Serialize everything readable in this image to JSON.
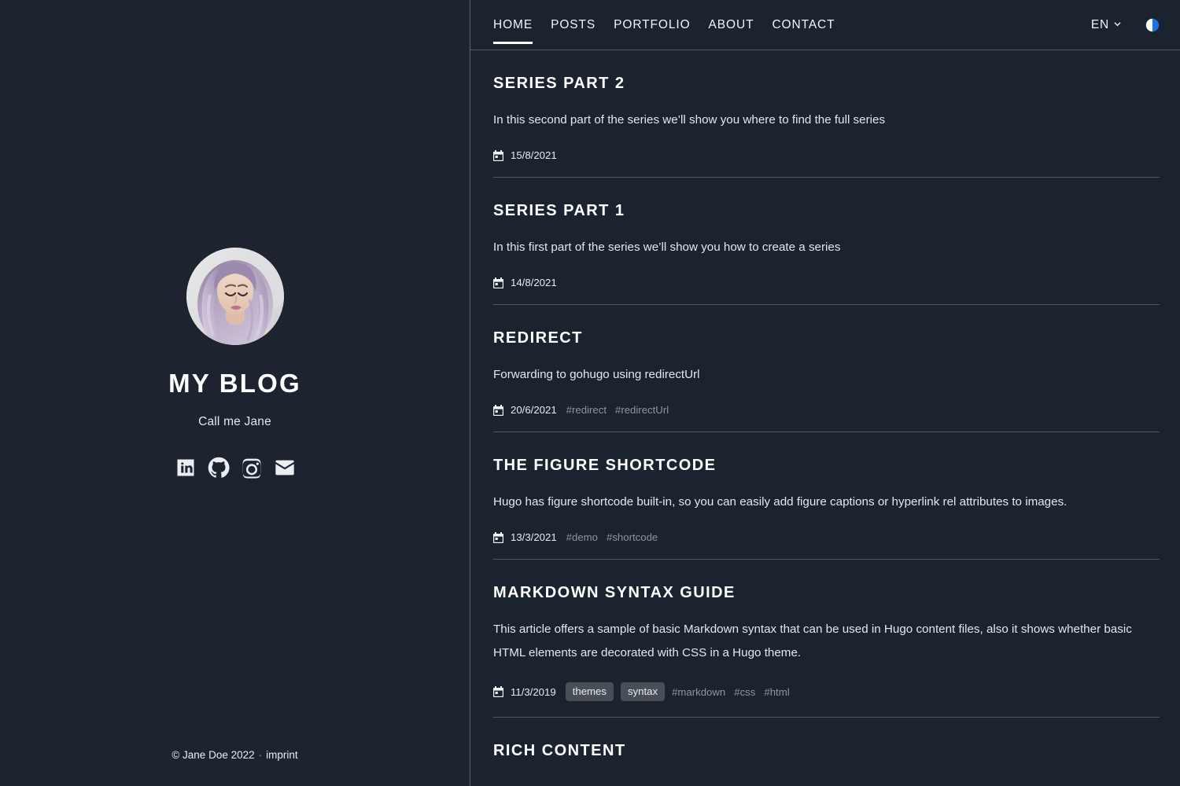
{
  "sidebar": {
    "avatar_alt": "profile-photo",
    "blog_title": "MY BLOG",
    "tagline": "Call me Jane",
    "socials": [
      {
        "name": "linkedin",
        "label": "LinkedIn"
      },
      {
        "name": "github",
        "label": "GitHub"
      },
      {
        "name": "instagram",
        "label": "Instagram"
      },
      {
        "name": "email",
        "label": "Email"
      }
    ],
    "footer": {
      "copyright": "© Jane Doe 2022",
      "separator": "·",
      "imprint_label": "imprint"
    }
  },
  "header": {
    "nav": [
      {
        "label": "HOME",
        "active": true
      },
      {
        "label": "POSTS",
        "active": false
      },
      {
        "label": "PORTFOLIO",
        "active": false
      },
      {
        "label": "ABOUT",
        "active": false
      },
      {
        "label": "CONTACT",
        "active": false
      }
    ],
    "language": "EN",
    "language_icon": "chevron-down-icon",
    "theme_toggle_icon": "half-circle-icon",
    "theme_toggle_color": "#1a73e8"
  },
  "posts": [
    {
      "title": "SERIES PART 2",
      "summary": "In this second part of the series we’ll show you where to find the full series",
      "date": "15/8/2021",
      "categories": [],
      "tags": []
    },
    {
      "title": "SERIES PART 1",
      "summary": "In this first part of the series we’ll show you how to create a series",
      "date": "14/8/2021",
      "categories": [],
      "tags": []
    },
    {
      "title": "REDIRECT",
      "summary": "Forwarding to gohugo using redirectUrl",
      "date": "20/6/2021",
      "categories": [],
      "tags": [
        "#redirect",
        "#redirectUrl"
      ]
    },
    {
      "title": "THE FIGURE SHORTCODE",
      "summary": "Hugo has figure shortcode built-in, so you can easily add figure captions or hyperlink rel attributes to images.",
      "date": "13/3/2021",
      "categories": [],
      "tags": [
        "#demo",
        "#shortcode"
      ]
    },
    {
      "title": "MARKDOWN SYNTAX GUIDE",
      "summary": "This article offers a sample of basic Markdown syntax that can be used in Hugo content files, also it shows whether basic HTML elements are decorated with CSS in a Hugo theme.",
      "date": "11/3/2019",
      "categories": [
        "themes",
        "syntax"
      ],
      "tags": [
        "#markdown",
        "#css",
        "#html"
      ]
    },
    {
      "title": "RICH CONTENT",
      "summary": "",
      "date": "",
      "categories": [],
      "tags": []
    }
  ],
  "theme": {
    "sidebar_bg": "#1d2430",
    "main_bg": "#1b232e",
    "divider": "#5d6168",
    "text": "#e8eaed",
    "muted": "#8e959e",
    "badge_bg": "#4a4f57"
  }
}
